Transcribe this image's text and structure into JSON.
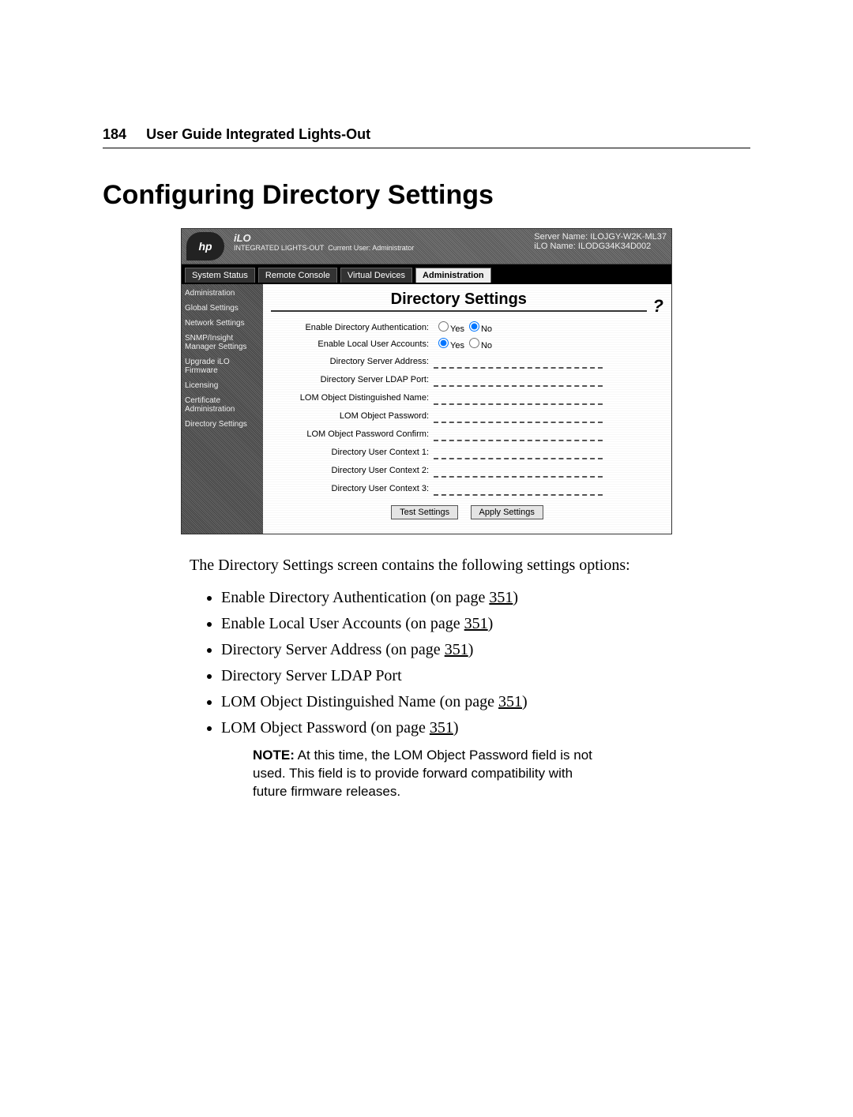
{
  "header": {
    "page_number": "184",
    "book_title": "User Guide Integrated Lights-Out"
  },
  "title": "Configuring Directory Settings",
  "screenshot": {
    "logo_text": "hp",
    "ilo_label": "iLO",
    "ilo_sub": "INTEGRATED LIGHTS-OUT",
    "server_name_label": "Server Name:",
    "server_name_value": "ILOJGY-W2K-ML37",
    "ilo_name_label": "iLO Name:",
    "ilo_name_value": "ILODG34K34D002",
    "current_user_label": "Current User:",
    "current_user_value": "Administrator",
    "tabs": [
      "System Status",
      "Remote Console",
      "Virtual Devices",
      "Administration"
    ],
    "active_tab_index": 3,
    "sidebar": {
      "items": [
        "Administration",
        "Global Settings",
        "Network Settings",
        "SNMP/Insight Manager Settings",
        "Upgrade iLO Firmware",
        "Licensing",
        "Certificate Administration",
        "Directory Settings"
      ]
    },
    "panel_title": "Directory Settings",
    "help_glyph": "?",
    "form": {
      "rows": [
        {
          "label": "Enable Directory Authentication:",
          "type": "radio",
          "opt1": "Yes",
          "opt2": "No",
          "selected": 1
        },
        {
          "label": "Enable Local User Accounts:",
          "type": "radio",
          "opt1": "Yes",
          "opt2": "No",
          "selected": 0
        },
        {
          "label": "Directory Server Address:",
          "type": "text"
        },
        {
          "label": "Directory Server LDAP Port:",
          "type": "text"
        },
        {
          "label": "LOM Object Distinguished Name:",
          "type": "text"
        },
        {
          "label": "LOM Object Password:",
          "type": "password"
        },
        {
          "label": "LOM Object Password Confirm:",
          "type": "password"
        },
        {
          "label": "Directory User Context 1:",
          "type": "text"
        },
        {
          "label": "Directory User Context 2:",
          "type": "text"
        },
        {
          "label": "Directory User Context 3:",
          "type": "text"
        }
      ],
      "buttons": {
        "test": "Test Settings",
        "apply": "Apply Settings"
      }
    }
  },
  "intro": "The Directory Settings screen contains the following settings options:",
  "options": [
    {
      "text": "Enable Directory Authentication (on page ",
      "link": "351",
      "tail": ")"
    },
    {
      "text": "Enable Local User Accounts (on page ",
      "link": "351",
      "tail": ")"
    },
    {
      "text": "Directory Server Address (on page ",
      "link": "351",
      "tail": ")"
    },
    {
      "text": "Directory Server LDAP Port",
      "link": "",
      "tail": ""
    },
    {
      "text": "LOM Object Distinguished Name (on page ",
      "link": "351",
      "tail": ")"
    },
    {
      "text": "LOM Object Password (on page ",
      "link": "351",
      "tail": ")"
    }
  ],
  "note": {
    "label": "NOTE:",
    "body": " At this time, the LOM Object Password field is not used. This field is to provide forward compatibility with future firmware releases."
  }
}
